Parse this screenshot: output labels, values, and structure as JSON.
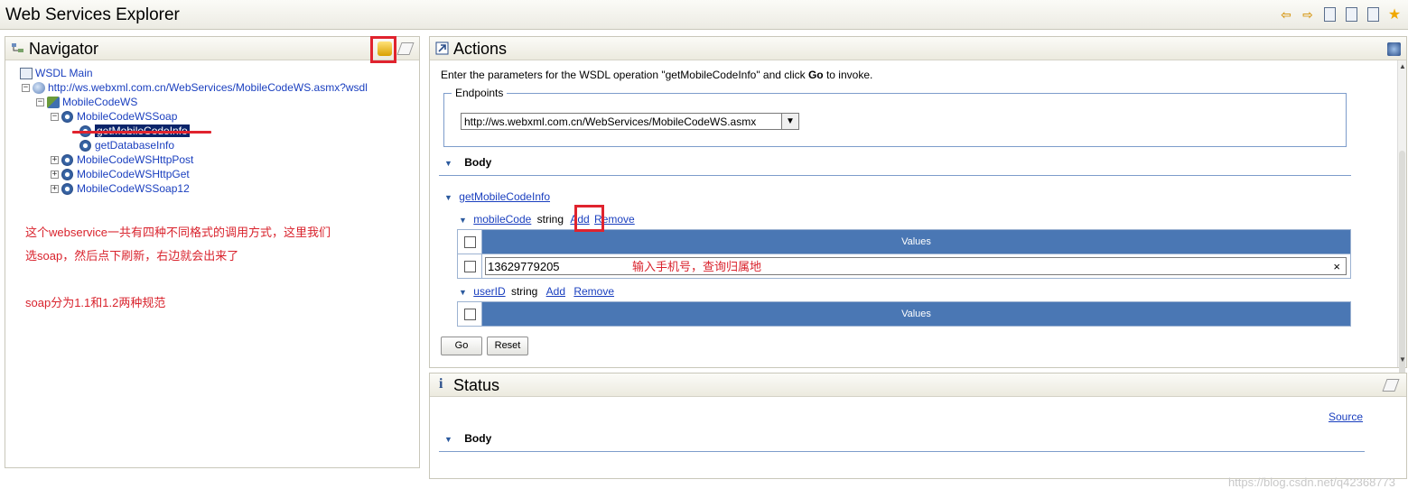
{
  "window": {
    "title": "Web Services Explorer"
  },
  "toolbar": {
    "icons": [
      "back-arrow-icon",
      "forward-arrow-icon",
      "wsdl-page-icon",
      "uddi-page-icon",
      "wsil-page-icon",
      "favorites-icon"
    ]
  },
  "navigator": {
    "title": "Navigator",
    "tree": {
      "root": "WSDL Main",
      "wsdl_url": "http://ws.webxml.com.cn/WebServices/MobileCodeWS.asmx?wsdl",
      "service": "MobileCodeWS",
      "binding_soap": "MobileCodeWSSoap",
      "op_selected": "getMobileCodeInfo",
      "op_other": "getDatabaseInfo",
      "binding_http_post": "MobileCodeWSHttpPost",
      "binding_http_get": "MobileCodeWSHttpGet",
      "binding_soap12": "MobileCodeWSSoap12"
    },
    "notes": {
      "line1": "这个webservice一共有四种不同格式的调用方式，这里我们",
      "line2": "选soap，然后点下刷新，右边就会出来了",
      "line3": "soap分为1.1和1.2两种规范"
    }
  },
  "actions": {
    "title": "Actions",
    "intro_prefix": "Enter the parameters for the WSDL operation \"getMobileCodeInfo\" and click ",
    "intro_go": "Go",
    "intro_suffix": " to invoke.",
    "endpoints_legend": "Endpoints",
    "endpoint_value": "http://ws.webxml.com.cn/WebServices/MobileCodeWS.asmx",
    "body_label": "Body",
    "operation_link": "getMobileCodeInfo",
    "params": [
      {
        "name": "mobileCode",
        "type": "string",
        "add": "Add",
        "remove": "Remove",
        "values_header": "Values",
        "value": "13629779205",
        "hint": "输入手机号，查询归属地",
        "clear": "×"
      },
      {
        "name": "userID",
        "type": "string",
        "add": "Add",
        "remove": "Remove",
        "values_header": "Values"
      }
    ],
    "go_button": "Go",
    "reset_button": "Reset"
  },
  "status": {
    "title": "Status",
    "source_link": "Source",
    "body_label": "Body"
  },
  "watermark": "https://blog.csdn.net/q42368773",
  "colors": {
    "accent": "#4a77b4",
    "link": "#1a3fbf",
    "annotation": "#e0232e"
  }
}
